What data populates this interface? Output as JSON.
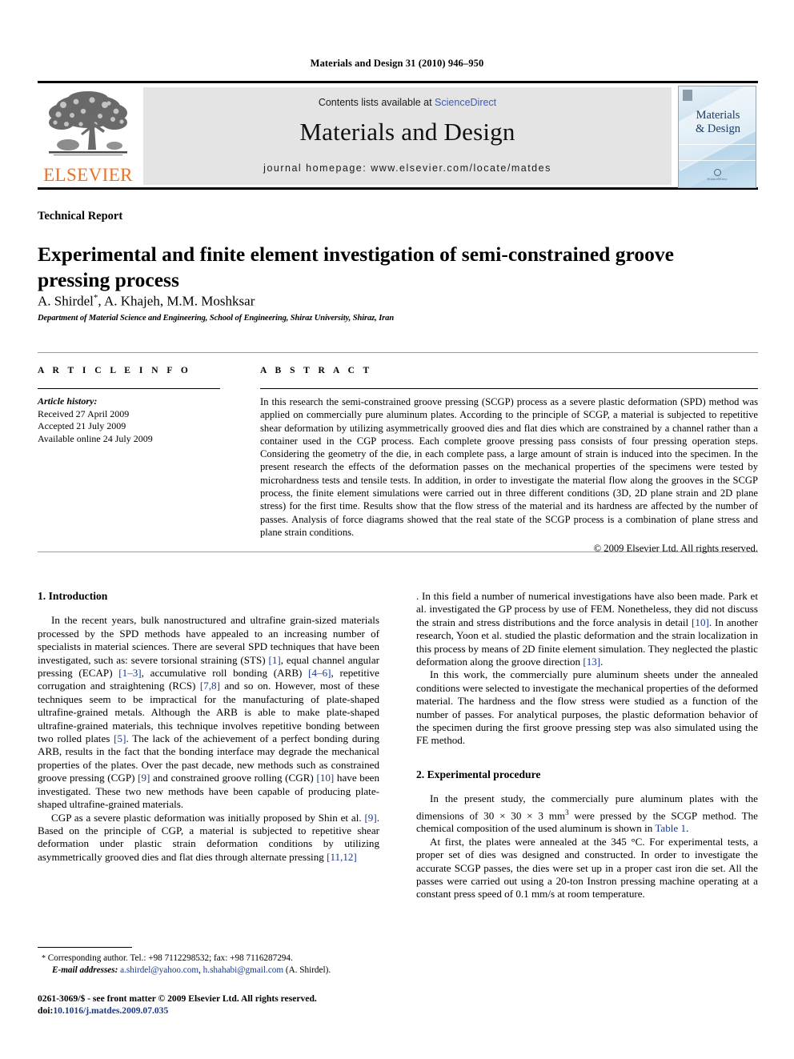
{
  "running_head": "Materials and Design 31 (2010) 946–950",
  "masthead": {
    "publisher_name": "ELSEVIER",
    "contents_prefix": "Contents lists available at ",
    "contents_link": "ScienceDirect",
    "journal_title": "Materials and Design",
    "homepage_line": "journal homepage: www.elsevier.com/locate/matdes",
    "cover_title_line1": "Materials",
    "cover_title_line2": "& Design",
    "cover_footer": "ScienceDirect",
    "link_color": "#3b5bbd",
    "elsevier_orange": "#ea7125"
  },
  "article": {
    "section_type": "Technical Report",
    "title": "Experimental and finite element investigation of semi-constrained groove pressing process",
    "authors": "A. Shirdel",
    "authors_rest": ", A. Khajeh, M.M. Moshksar",
    "corresponding_marker": "*",
    "affiliation": "Department of Material Science and Engineering, School of Engineering, Shiraz University, Shiraz, Iran"
  },
  "info": {
    "heading": "A R T I C L E   I N F O",
    "history_label": "Article history:",
    "received": "Received 27 April 2009",
    "accepted": "Accepted 21 July 2009",
    "available": "Available online 24 July 2009"
  },
  "abstract": {
    "heading": "A B S T R A C T",
    "text": "In this research the semi-constrained groove pressing (SCGP) process as a severe plastic deformation (SPD) method was applied on commercially pure aluminum plates. According to the principle of SCGP, a material is subjected to repetitive shear deformation by utilizing asymmetrically grooved dies and flat dies which are constrained by a channel rather than a container used in the CGP process. Each complete groove pressing pass consists of four pressing operation steps. Considering the geometry of the die, in each complete pass, a large amount of strain is induced into the specimen. In the present research the effects of the deformation passes on the mechanical properties of the specimens were tested by microhardness tests and tensile tests. In addition, in order to investigate the material flow along the grooves in the SCGP process, the finite element simulations were carried out in three different conditions (3D, 2D plane strain and 2D plane stress) for the first time. Results show that the flow stress of the material and its hardness are affected by the number of passes. Analysis of force diagrams showed that the real state of the SCGP process is a combination of plane stress and plane strain conditions.",
    "copyright": "© 2009 Elsevier Ltd. All rights reserved."
  },
  "body": {
    "intro_heading": "1. Introduction",
    "intro_p1_a": "In the recent years, bulk nanostructured and ultrafine grain-sized materials processed by the SPD methods have appealed to an increasing number of specialists in material sciences. There are several SPD techniques that have been investigated, such as: severe torsional straining (STS) ",
    "ref_1": "[1]",
    "intro_p1_b": ", equal channel angular pressing (ECAP) ",
    "ref_1_3": "[1–3]",
    "intro_p1_c": ", accumulative roll bonding (ARB) ",
    "ref_4_6": "[4–6]",
    "intro_p1_d": ", repetitive corrugation and straightening (RCS) ",
    "ref_7_8": "[7,8]",
    "intro_p1_e": " and so on. However, most of these techniques seem to be impractical for the manufacturing of plate-shaped ultrafine-grained metals. Although the ARB is able to make plate-shaped ultrafine-grained materials, this technique involves repetitive bonding between two rolled plates ",
    "ref_5": "[5]",
    "intro_p1_f": ". The lack of the achievement of a perfect bonding during ARB, results in the fact that the bonding interface may degrade the mechanical properties of the plates. Over the past decade, new methods such as constrained groove pressing (CGP) ",
    "ref_9": "[9]",
    "intro_p1_g": " and constrained groove rolling (CGR) ",
    "ref_10": "[10]",
    "intro_p1_h": " have been investigated. These two new methods have been capable of producing plate-shaped ultrafine-grained materials.",
    "intro_p2_a": "CGP as a severe plastic deformation was initially proposed by Shin et al. ",
    "ref_9b": "[9]",
    "intro_p2_b": ". Based on the principle of CGP, a material is subjected to repetitive shear deformation under plastic strain deformation conditions by utilizing asymmetrically grooved dies and flat dies through alternate pressing ",
    "ref_11_12": "[11,12]",
    "intro_p2_c": ". In this field a number of numerical investigations have also been made. Park et al. investigated the GP process by use of FEM. Nonetheless, they did not discuss the strain and stress distributions and the force analysis in detail ",
    "ref_10b": "[10]",
    "intro_p2_d": ". In another research, Yoon et al. studied the plastic deformation and the strain localization in this process by means of 2D finite element simulation. They neglected the plastic deformation along the groove direction ",
    "ref_13": "[13]",
    "intro_p2_e": ".",
    "intro_p3": "In this work, the commercially pure aluminum sheets under the annealed conditions were selected to investigate the mechanical properties of the deformed material. The hardness and the flow stress were studied as a function of the number of passes. For analytical purposes, the plastic deformation behavior of the specimen during the first groove pressing step was also simulated using the FE method.",
    "exp_heading": "2. Experimental procedure",
    "exp_p1_a": "In the present study, the commercially pure aluminum plates with the dimensions of 30 × 30 × 3 mm",
    "exp_p1_sup": "3",
    "exp_p1_b": " were pressed by the SCGP method. The chemical composition of the used aluminum is shown in ",
    "table_link": "Table 1",
    "exp_p1_c": ".",
    "exp_p2": "At first, the plates were annealed at the 345 °C. For experimental tests, a proper set of dies was designed and constructed. In order to investigate the accurate SCGP passes, the dies were set up in a proper cast iron die set. All the passes were carried out using a 20-ton Instron pressing machine operating at a constant press speed of 0.1 mm/s at room temperature."
  },
  "footnote": {
    "star": "*",
    "corresponding": " Corresponding author. Tel.: +98 7112298532; fax: +98 7116287294.",
    "email_label": "E-mail addresses:",
    "email1": "a.shirdel@yahoo.com",
    "email_sep": ", ",
    "email2": "h.shahabi@gmail.com",
    "email_tail": " (A. Shirdel)."
  },
  "imprint": {
    "line1": "0261-3069/$ - see front matter © 2009 Elsevier Ltd. All rights reserved.",
    "doi_label": "doi:",
    "doi_value": "10.1016/j.matdes.2009.07.035"
  }
}
